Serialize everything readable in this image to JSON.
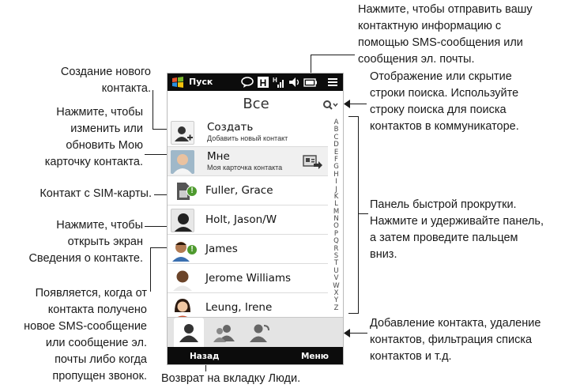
{
  "statusbar": {
    "start_label": "Пуск"
  },
  "title": "Все",
  "contacts": [
    {
      "name": "Создать",
      "sub": "Добавить новый контакт"
    },
    {
      "name": "Мне",
      "sub": "Моя карточка контакта"
    },
    {
      "name": "Fuller, Grace"
    },
    {
      "name": "Holt, Jason/W"
    },
    {
      "name": "James"
    },
    {
      "name": "Jerome Williams"
    },
    {
      "name": "Leung, Irene"
    }
  ],
  "alphabet": [
    "A",
    "B",
    "C",
    "D",
    "E",
    "F",
    "G",
    "H",
    "I",
    "J",
    "K",
    "L",
    "M",
    "N",
    "O",
    "P",
    "Q",
    "R",
    "S",
    "T",
    "U",
    "V",
    "W",
    "X",
    "Y",
    "Z"
  ],
  "softkeys": {
    "left": "Назад",
    "right": "Меню"
  },
  "callouts": {
    "new_contact": [
      "Создание нового",
      "контакта."
    ],
    "my_card": [
      "Нажмите, чтобы",
      "изменить или",
      "обновить Мою",
      "карточку контакта."
    ],
    "sim": [
      "Контакт с SIM-карты."
    ],
    "details": [
      "Нажмите, чтобы",
      "открыть экран",
      "Сведения о контакте."
    ],
    "new_msg": [
      "Появляется, когда от",
      "контакта получено",
      "новое SMS-сообщение",
      "или сообщение эл.",
      "почты либо когда",
      "пропущен звонок."
    ],
    "send_card": [
      "Нажмите, чтобы отправить вашу",
      "контактную информацию с",
      "помощью SMS-сообщения или",
      "сообщения эл. почты."
    ],
    "search": [
      "Отображение или скрытие",
      "строки поиска. Используйте",
      "строку поиска для поиска",
      "контактов в коммуникаторе."
    ],
    "scroll": [
      "Панель быстрой прокрутки.",
      "Нажмите и удерживайте панель,",
      "а затем проведите пальцем",
      "вниз."
    ],
    "tabs": [
      "Добавление контакта, удаление",
      "контактов, фильтрация списка",
      "контактов и т.д."
    ],
    "back": [
      "Возврат на вкладку Люди."
    ]
  },
  "colors": {
    "statusbar": "#0c0c0c",
    "badge": "#4e9a2e",
    "tabs": "#e4e4e4"
  }
}
